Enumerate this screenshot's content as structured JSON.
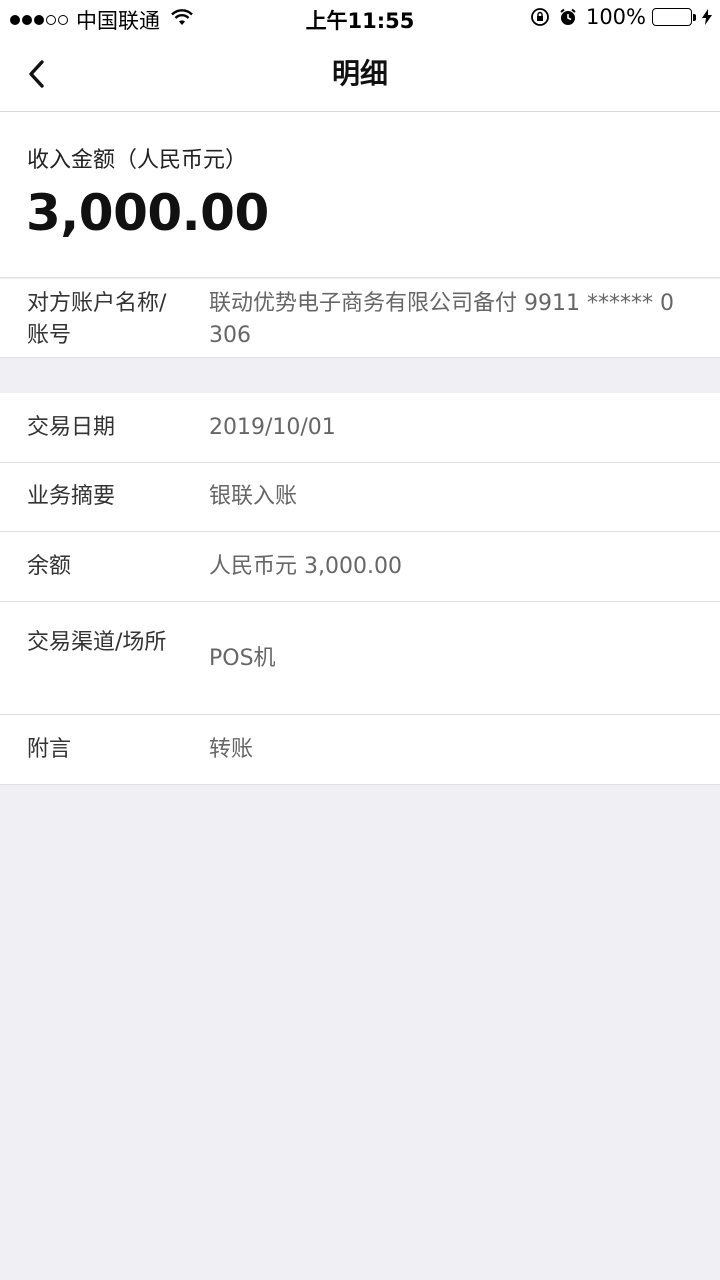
{
  "status_bar": {
    "carrier": "中国联通",
    "time": "上午11:55",
    "battery_pct": "100%",
    "battery_level": 1.0,
    "battery_color": "#4cd964"
  },
  "nav": {
    "title": "明细",
    "back_icon": "chevron-left-icon"
  },
  "amount": {
    "label": "收入金额（人民币元）",
    "value": "3,000.00"
  },
  "counterparty": {
    "label": "对方账户名称/账号",
    "value": "联动优势电子商务有限公司备付 9911 ****** 0306"
  },
  "details": [
    {
      "label": "交易日期",
      "value": "2019/10/01"
    },
    {
      "label": "业务摘要",
      "value": "银联入账"
    },
    {
      "label": "余额",
      "value": "人民币元 3,000.00"
    },
    {
      "label": "交易渠道/场所",
      "value": "POS机"
    },
    {
      "label": "附言",
      "value": "转账"
    }
  ],
  "colors": {
    "background": "#efeff4",
    "card": "#ffffff"
  }
}
